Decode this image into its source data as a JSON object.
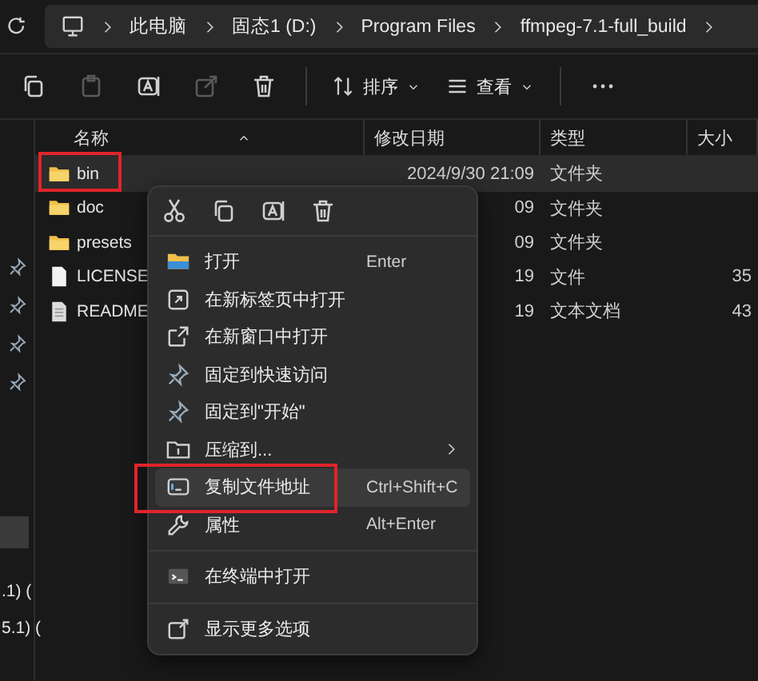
{
  "address_bar": {
    "crumbs": [
      "此电脑",
      "固态1 (D:)",
      "Program Files",
      "ffmpeg-7.1-full_build"
    ]
  },
  "toolbar": {
    "actions": [
      {
        "kind": "copy",
        "disabled": false
      },
      {
        "kind": "paste",
        "disabled": true
      },
      {
        "kind": "rename",
        "disabled": false
      },
      {
        "kind": "share",
        "disabled": true
      },
      {
        "kind": "delete",
        "disabled": false
      }
    ],
    "sort": "排序",
    "view": "查看"
  },
  "sidebar": {
    "items": [
      {
        "kind": "pin"
      },
      {
        "kind": "pin"
      },
      {
        "kind": "pin"
      },
      {
        "kind": "pin"
      },
      {
        "kind": "blank",
        "selected": true
      },
      {
        "kind": "text",
        "label": ".1) ("
      },
      {
        "kind": "text",
        "label": "5.1) ("
      }
    ]
  },
  "file_list": {
    "columns": [
      "名称",
      "修改日期",
      "类型",
      "大小"
    ],
    "rows": [
      {
        "kind": "folder",
        "name": "bin",
        "date": "2024/9/30 21:09",
        "type": "文件夹",
        "selected": true,
        "marked": true
      },
      {
        "kind": "folder",
        "name": "doc",
        "date": "09",
        "type": "文件夹",
        "selected": false,
        "marked": false
      },
      {
        "kind": "folder",
        "name": "presets",
        "date": "09",
        "type": "文件夹",
        "selected": false,
        "marked": false
      },
      {
        "kind": "file",
        "name": "LICENSE",
        "date": "19",
        "type": "文件",
        "size": "35",
        "selected": false,
        "marked": false
      },
      {
        "kind": "doc",
        "name": "README",
        "date": "19",
        "type": "文本文档",
        "size": "43",
        "selected": false,
        "marked": false
      }
    ]
  },
  "context_menu": {
    "actions": [
      {
        "kind": "cut"
      },
      {
        "kind": "copy"
      },
      {
        "kind": "rename"
      },
      {
        "kind": "delete"
      }
    ],
    "items": [
      {
        "kind": "item",
        "label": "打开",
        "shortcut": "Enter",
        "highlighted": false
      },
      {
        "kind": "item",
        "label": "在新标签页中打开",
        "highlighted": false
      },
      {
        "kind": "item",
        "label": "在新窗口中打开",
        "highlighted": false
      },
      {
        "kind": "item",
        "label": "固定到快速访问",
        "highlighted": false
      },
      {
        "kind": "item",
        "label": "固定到\"开始\"",
        "highlighted": false
      },
      {
        "kind": "item",
        "label": "压缩到...",
        "highlighted": false,
        "submenu": true
      },
      {
        "kind": "item",
        "label": "复制文件地址",
        "shortcut": "Ctrl+Shift+C",
        "highlighted": true,
        "marked": true
      },
      {
        "kind": "item",
        "label": "属性",
        "shortcut": "Alt+Enter",
        "highlighted": false
      },
      {
        "kind": "separator"
      },
      {
        "kind": "item",
        "label": "在终端中打开",
        "highlighted": false
      },
      {
        "kind": "separator"
      },
      {
        "kind": "item",
        "label": "显示更多选项",
        "highlighted": false
      }
    ]
  }
}
